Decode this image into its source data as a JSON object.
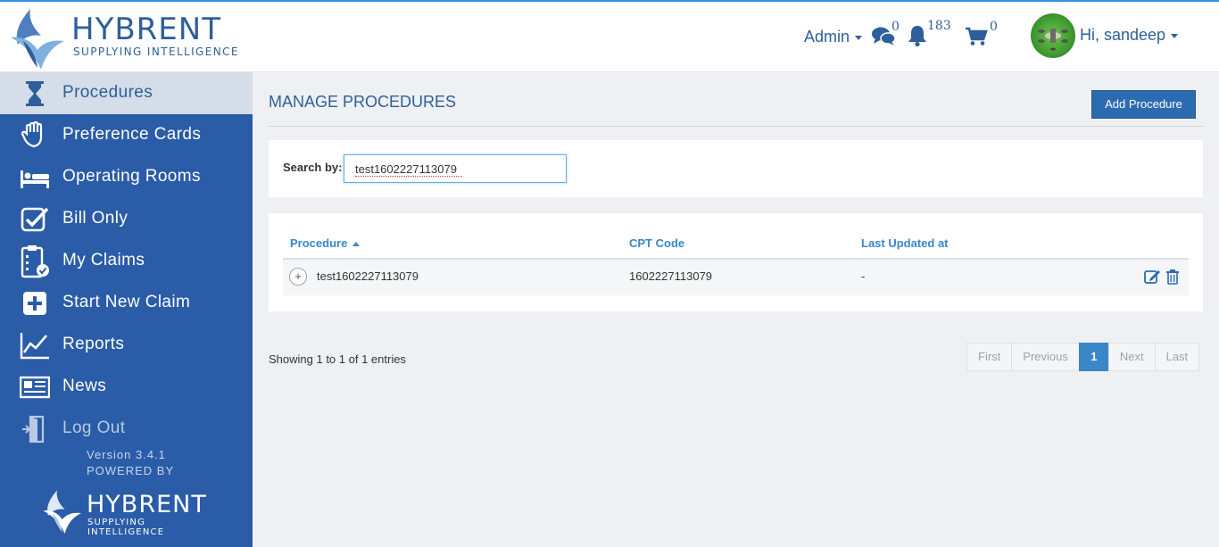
{
  "brand": {
    "name": "HYBRENT",
    "tagline": "SUPPLYING INTELLIGENCE"
  },
  "header": {
    "admin_label": "Admin",
    "messages_count": "0",
    "notifications_count": "183",
    "cart_count": "0",
    "greeting": "Hi, sandeep"
  },
  "sidebar": {
    "items": [
      {
        "label": "Procedures",
        "icon": "hourglass-icon",
        "active": true
      },
      {
        "label": "Preference Cards",
        "icon": "glove-icon"
      },
      {
        "label": "Operating Rooms",
        "icon": "bed-icon"
      },
      {
        "label": "Bill Only",
        "icon": "checkbox-icon"
      },
      {
        "label": "My Claims",
        "icon": "clipboard-check-icon"
      },
      {
        "label": "Start New Claim",
        "icon": "plus-square-icon"
      },
      {
        "label": "Reports",
        "icon": "line-chart-icon"
      },
      {
        "label": "News",
        "icon": "newspaper-icon"
      },
      {
        "label": "Log Out",
        "icon": "door-exit-icon"
      }
    ],
    "version": "Version 3.4.1",
    "powered_by": "POWERED BY"
  },
  "main": {
    "title": "MANAGE PROCEDURES",
    "add_button": "Add Procedure",
    "search": {
      "label": "Search by:",
      "value": "test1602227113079"
    },
    "table": {
      "columns": [
        "Procedure",
        "CPT Code",
        "Last Updated at"
      ],
      "rows": [
        {
          "expander": "+",
          "procedure": "test1602227113079",
          "cpt": "1602227113079",
          "updated": "-"
        }
      ]
    },
    "showing": "Showing 1 to 1 of 1 entries",
    "pagination": {
      "first": "First",
      "previous": "Previous",
      "current": "1",
      "next": "Next",
      "last": "Last"
    }
  },
  "colors": {
    "sidebar": "#2a5ca8",
    "accent": "#3a86c8",
    "brand": "#2f5f9a"
  }
}
